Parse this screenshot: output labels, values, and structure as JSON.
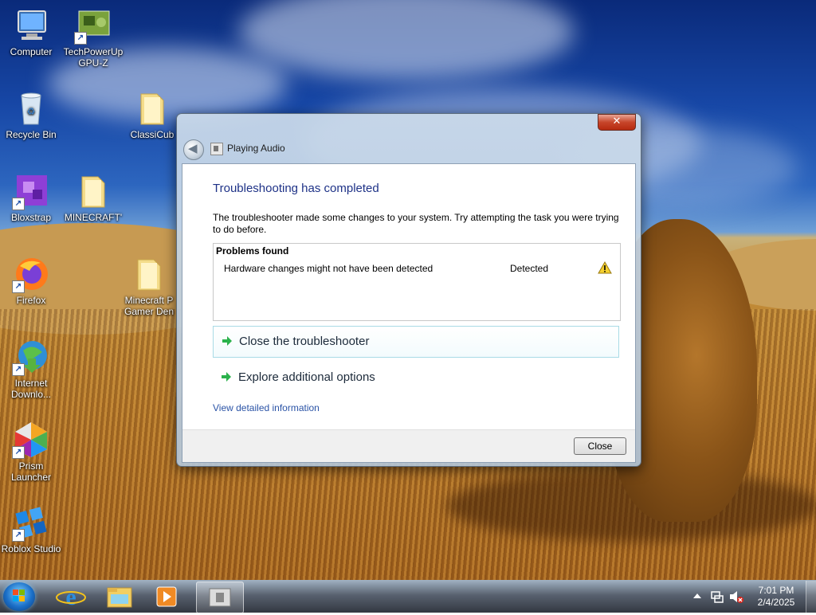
{
  "desktop": {
    "icons": [
      {
        "label": "Computer",
        "icon": "computer-icon"
      },
      {
        "label": "TechPowerUp GPU-Z",
        "icon": "gpuz-icon"
      },
      {
        "label": "Recycle Bin",
        "icon": "recycle-bin-icon"
      },
      {
        "label": "ClassiCub",
        "icon": "folder-icon"
      },
      {
        "label": "Bloxstrap",
        "icon": "bloxstrap-icon"
      },
      {
        "label": "MINECRAFT'",
        "icon": "folder-icon"
      },
      {
        "label": "Firefox",
        "icon": "firefox-icon"
      },
      {
        "label": "Minecraft P Gamer Den",
        "icon": "folder-icon"
      },
      {
        "label": "Internet Downlo...",
        "icon": "internet-download-icon"
      },
      {
        "label": "Prism Launcher",
        "icon": "prism-launcher-icon"
      },
      {
        "label": "Roblox Studio",
        "icon": "roblox-studio-icon"
      }
    ]
  },
  "dialog": {
    "close_glyph": "✕",
    "title": "Playing Audio",
    "heading": "Troubleshooting has completed",
    "description": "The troubleshooter made some changes to your system. Try attempting the task you were trying to do before.",
    "problems": {
      "header": "Problems found",
      "items": [
        {
          "name": "Hardware changes might not have been detected",
          "status": "Detected",
          "icon": "warning-icon"
        }
      ]
    },
    "options": [
      {
        "label": "Close the troubleshooter",
        "icon": "green-arrow-icon"
      },
      {
        "label": "Explore additional options",
        "icon": "green-arrow-icon"
      }
    ],
    "link": "View detailed information",
    "close_button": "Close"
  },
  "taskbar": {
    "pinned": [
      "start-orb-icon",
      "internet-explorer-icon",
      "file-explorer-icon",
      "media-player-icon",
      "troubleshooter-icon"
    ],
    "clock": {
      "time": "7:01 PM",
      "date": "2/4/2025"
    },
    "tray_icons": [
      "show-hidden-icons",
      "network-icon",
      "volume-muted-icon"
    ]
  },
  "colors": {
    "heading": "#1e3287",
    "link": "#2a53a6",
    "close_red": "#c7452a"
  }
}
